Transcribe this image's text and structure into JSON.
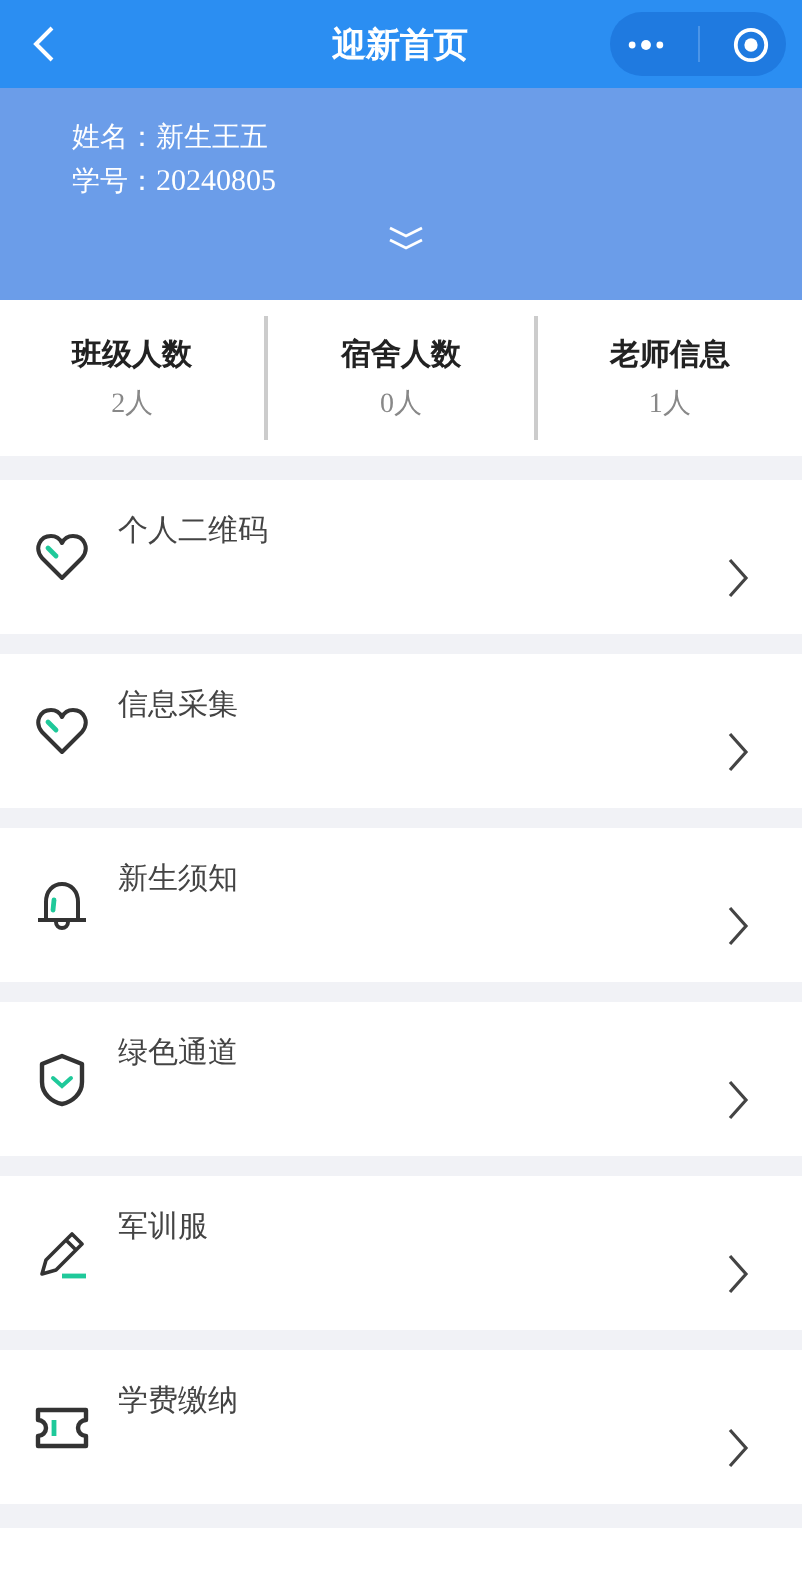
{
  "nav_bar": {
    "title": "迎新首页"
  },
  "student": {
    "name_label": "姓名：",
    "name": "新生王五",
    "id_label": "学号：",
    "id": "20240805"
  },
  "stats": [
    {
      "label": "班级人数",
      "value": "2人"
    },
    {
      "label": "宿舍人数",
      "value": "0人"
    },
    {
      "label": "老师信息",
      "value": "1人"
    }
  ],
  "menu": [
    {
      "label": "个人二维码"
    },
    {
      "label": "信息采集"
    },
    {
      "label": "新生须知"
    },
    {
      "label": "绿色通道"
    },
    {
      "label": "军训服"
    },
    {
      "label": "学费缴纳"
    }
  ]
}
